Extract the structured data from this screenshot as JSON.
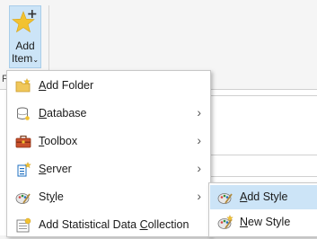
{
  "ribbon": {
    "add_item": {
      "line1": "Add",
      "line2": "Item",
      "chevron": "⌄",
      "icon": "star-plus-icon"
    },
    "group_letter": "F"
  },
  "menu": {
    "items": [
      {
        "pre": "",
        "key": "A",
        "post": "dd Folder",
        "icon": "folder-add-icon",
        "has_submenu": false
      },
      {
        "pre": "",
        "key": "D",
        "post": "atabase",
        "icon": "database-icon",
        "has_submenu": true
      },
      {
        "pre": "",
        "key": "T",
        "post": "oolbox",
        "icon": "toolbox-icon",
        "has_submenu": true
      },
      {
        "pre": "",
        "key": "S",
        "post": "erver",
        "icon": "server-icon",
        "has_submenu": true
      },
      {
        "pre": "St",
        "key": "y",
        "post": "le",
        "icon": "style-icon",
        "has_submenu": true
      },
      {
        "pre": "Add Statistical Data ",
        "key": "C",
        "post": "ollection",
        "icon": "data-collection-icon",
        "has_submenu": false
      }
    ],
    "arrow": "›"
  },
  "submenu": {
    "items": [
      {
        "pre": "",
        "key": "A",
        "post": "dd Style",
        "icon": "add-style-icon",
        "highlighted": true
      },
      {
        "pre": "",
        "key": "N",
        "post": "ew Style",
        "icon": "new-style-icon",
        "highlighted": false
      }
    ]
  },
  "colors": {
    "highlight": "#cce4f7",
    "star": "#f2c230",
    "accent": "#1e6fc0"
  }
}
